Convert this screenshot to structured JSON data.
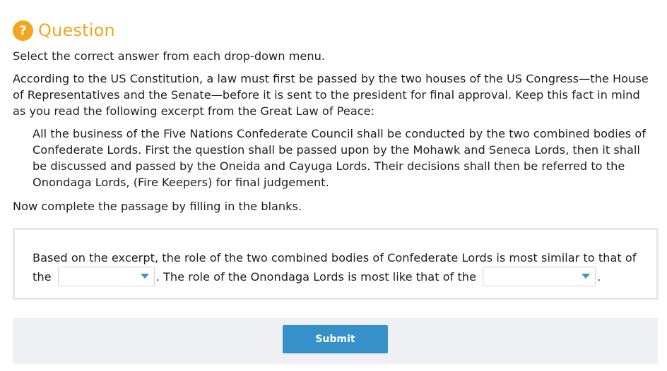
{
  "header": {
    "icon_glyph": "?",
    "title": "Question"
  },
  "instructions": "Select the correct answer from each drop-down menu.",
  "intro": "According to the US Constitution, a law must first be passed by the two houses of the US Congress—the House of Representatives and the Senate—before it is sent to the president for final approval. Keep this fact in mind as you read the following excerpt from the Great Law of Peace:",
  "excerpt": "All the business of the Five Nations Confederate Council shall be conducted by the two combined bodies of Confederate Lords. First the question shall be passed upon by the Mohawk and Seneca Lords, then it shall be discussed and passed by the Oneida and Cayuga Lords. Their decisions shall then be referred to the Onondaga Lords, (Fire Keepers) for final judgement.",
  "complete_prompt": "Now complete the passage by filling in the blanks.",
  "answer": {
    "part1": "Based on the excerpt, the role of the two combined bodies of Confederate Lords is most similar to that of the",
    "dropdown1_value": "",
    "part2": ". The role of the Onondaga Lords is most like that of the",
    "dropdown2_value": "",
    "part3": "."
  },
  "footer": {
    "submit_label": "Submit"
  },
  "colors": {
    "accent": "#f2a51f",
    "button": "#3691c9",
    "dropdown_arrow": "#3a93c8",
    "footer_bg": "#eef0f3"
  },
  "icons": {
    "question": "question-circle-icon",
    "dropdown": "caret-down-icon"
  }
}
